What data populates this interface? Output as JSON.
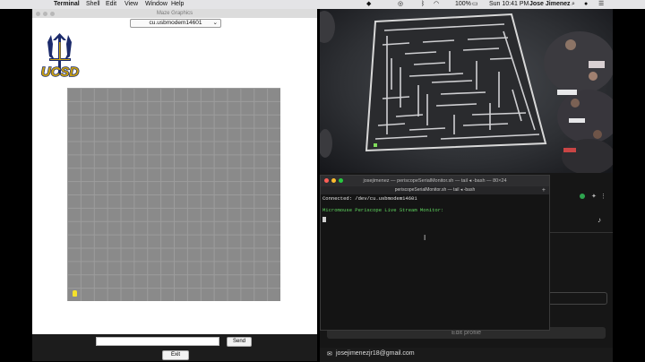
{
  "menubar": {
    "app": "Terminal",
    "menus": [
      "Shell",
      "Edit",
      "View",
      "Window",
      "Help"
    ],
    "battery": "100%",
    "clock": "Sun 10:41 PM",
    "user": "Jose Jimenez"
  },
  "maze_window": {
    "title": "Maze Graphics",
    "port": "cu.usbmodem14601",
    "logo": "UCSD",
    "send_label": "Send",
    "exit_label": "Exit",
    "grid_color": "#8a8a8a",
    "mouse_color": "#f4e12a"
  },
  "terminal": {
    "title": "josejimenez — periscopeSerialMonitor.sh — tail ◂ -bash — 80×24",
    "tab": "periscopeSerialMonitor.sh — tail ◂ -bash",
    "lines": [
      "Connected: /dev/cu.usbmodem14601",
      "Micromouse Periscope Live Stream Monitor:"
    ],
    "accent_green": "#5fd75f"
  },
  "right_panel": {
    "edit_profile": "Edit profile",
    "email": "josejimenezjr18@gmail.com"
  }
}
